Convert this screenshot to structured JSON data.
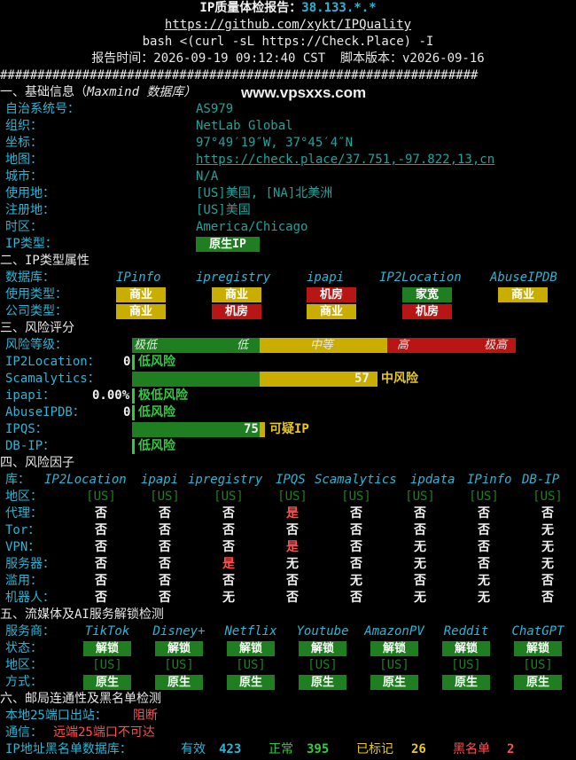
{
  "header": {
    "title_prefix": "IP质量体检报告：",
    "ip": "38.133.*.*",
    "repo": "https://github.com/xykt/IPQuality",
    "command": "bash <(curl -sL https://Check.Place) -I",
    "time_label": "报告时间：2026-09-19 09:12:40 CST  脚本版本：v2026-09-16",
    "separator": "################################################################"
  },
  "basic": {
    "section": "一、基础信息（",
    "section_db": "Maxmind 数据库）",
    "watermark": "www.vpsxxs.com",
    "rows": [
      {
        "label": "自治系统号：",
        "value": "AS979"
      },
      {
        "label": "组织：",
        "value": "NetLab Global"
      },
      {
        "label": "坐标：",
        "value": "97°49′19″W, 37°45′4″N"
      },
      {
        "label": "地图：",
        "value": "https://check.place/37.751,-97.822,13,cn"
      },
      {
        "label": "城市：",
        "value": "N/A"
      },
      {
        "label": "使用地：",
        "value": "[US]美国, [NA]北美洲"
      },
      {
        "label": "注册地：",
        "value": "[US]美国"
      },
      {
        "label": "时区：",
        "value": "America/Chicago"
      }
    ],
    "iptype_label": "IP类型：",
    "iptype_value": "原生IP"
  },
  "iptype": {
    "section": "二、IP类型属性",
    "db_label": "数据库：",
    "usage_label": "使用类型：",
    "company_label": "公司类型：",
    "dbs": [
      "IPinfo",
      "ipregistry",
      "ipapi",
      "IP2Location",
      "AbuseIPDB"
    ],
    "usage": [
      "商业",
      "商业",
      "机房",
      "家宽",
      "商业"
    ],
    "usage_colors": [
      "yellow",
      "yellow",
      "red",
      "green",
      "yellow"
    ],
    "company": [
      "商业",
      "机房",
      "商业",
      "机房"
    ],
    "company_colors": [
      "yellow",
      "red",
      "yellow",
      "red"
    ]
  },
  "risk": {
    "section": "三、风险评分",
    "level_label": "风险等级：",
    "levels": [
      "极低",
      "低",
      "中等",
      "高",
      "极高"
    ],
    "ip2location_label": "IP2Location：",
    "ip2location_value": "0",
    "ip2location_text": "低风险",
    "scamalytics_label": "Scamalytics：",
    "scamalytics_value": "57",
    "scamalytics_text": "中风险",
    "ipapi_label": "ipapi：",
    "ipapi_value": "0.00%",
    "ipapi_text": "极低风险",
    "abuse_label": "AbuseIPDB：",
    "abuse_value": "0",
    "abuse_text": "低风险",
    "ipqs_label": "IPQS：",
    "ipqs_value": "75",
    "ipqs_text": "可疑IP",
    "dbip_label": "DB-IP：",
    "dbip_text": "低风险"
  },
  "factors": {
    "section": "四、风险因子",
    "db_label": "库：",
    "dbs": [
      "IP2Location",
      "ipapi",
      "ipregistry",
      "IPQS",
      "Scamalytics",
      "ipdata",
      "IPinfo",
      "DB-IP"
    ],
    "rows": [
      {
        "label": "地区：",
        "values": [
          "[US]",
          "[US]",
          "[US]",
          "[US]",
          "[US]",
          "[US]",
          "[US]",
          "[US]"
        ],
        "colors": [
          "g",
          "g",
          "g",
          "g",
          "g",
          "g",
          "g",
          "g"
        ]
      },
      {
        "label": "代理：",
        "values": [
          "否",
          "否",
          "否",
          "是",
          "否",
          "否",
          "否",
          "否"
        ],
        "colors": [
          "n",
          "n",
          "n",
          "r",
          "n",
          "n",
          "n",
          "n"
        ]
      },
      {
        "label": "Tor：",
        "values": [
          "否",
          "否",
          "否",
          "否",
          "否",
          "否",
          "否",
          "无"
        ],
        "colors": [
          "n",
          "n",
          "n",
          "n",
          "n",
          "n",
          "n",
          "n"
        ]
      },
      {
        "label": "VPN：",
        "values": [
          "否",
          "否",
          "否",
          "是",
          "否",
          "无",
          "否",
          "无"
        ],
        "colors": [
          "n",
          "n",
          "n",
          "r",
          "n",
          "n",
          "n",
          "n"
        ]
      },
      {
        "label": "服务器：",
        "values": [
          "否",
          "否",
          "是",
          "无",
          "否",
          "无",
          "否",
          "无"
        ],
        "colors": [
          "n",
          "n",
          "r",
          "n",
          "n",
          "n",
          "n",
          "n"
        ]
      },
      {
        "label": "滥用：",
        "values": [
          "否",
          "否",
          "否",
          "否",
          "无",
          "否",
          "无",
          "否"
        ],
        "colors": [
          "n",
          "n",
          "n",
          "n",
          "n",
          "n",
          "n",
          "n"
        ]
      },
      {
        "label": "机器人：",
        "values": [
          "否",
          "否",
          "无",
          "否",
          "否",
          "无",
          "无",
          "否"
        ],
        "colors": [
          "n",
          "n",
          "n",
          "n",
          "n",
          "n",
          "n",
          "n"
        ]
      }
    ]
  },
  "media": {
    "section": "五、流媒体及AI服务解锁检测",
    "svc_label": "服务商：",
    "status_label": "状态：",
    "region_label": "地区：",
    "method_label": "方式：",
    "services": [
      "TikTok",
      "Disney+",
      "Netflix",
      "Youtube",
      "AmazonPV",
      "Reddit",
      "ChatGPT"
    ],
    "status": [
      "解锁",
      "解锁",
      "解锁",
      "解锁",
      "解锁",
      "解锁",
      "解锁"
    ],
    "region": [
      "[US]",
      "[US]",
      "[US]",
      "[US]",
      "[US]",
      "[US]",
      "[US]"
    ],
    "method": [
      "原生",
      "原生",
      "原生",
      "原生",
      "原生",
      "原生",
      "原生"
    ]
  },
  "mail": {
    "section": "六、邮局连通性及黑名单检测",
    "port_label": "本地25端口出站：",
    "port_value": "阻断",
    "comm_label": "通信：",
    "comm_value": "远端25端口不可达",
    "bl_label": "IP地址黑名单数据库：",
    "valid_label": "有效",
    "valid_value": "423",
    "normal_label": "正常",
    "normal_value": "395",
    "marked_label": "已标记",
    "marked_value": "26",
    "black_label": "黑名单",
    "black_value": "2"
  }
}
